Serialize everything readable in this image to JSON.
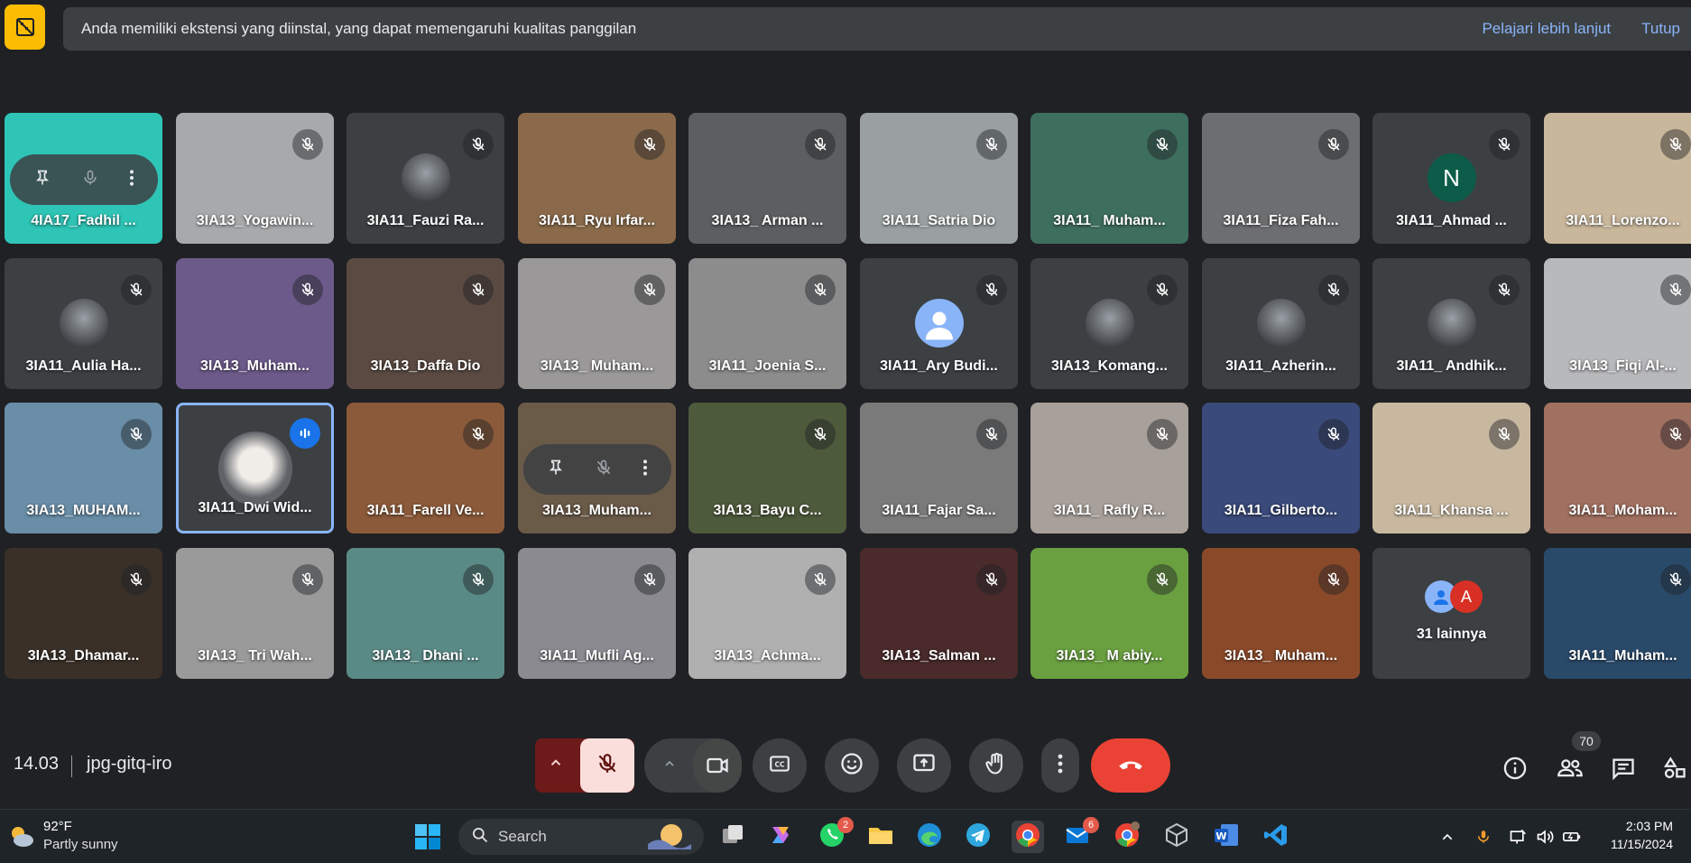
{
  "banner": {
    "message": "Anda memiliki ekstensi yang diinstal, yang dapat memengaruhi kualitas panggilan",
    "learn_more": "Pelajari lebih lanjut",
    "close": "Tutup"
  },
  "participants": [
    {
      "name": "4IA17_Fadhil ...",
      "bg": "#2ec4b6"
    },
    {
      "name": "3IA13_Yogawin...",
      "bg": "#a8a9ab"
    },
    {
      "name": "3IA11_Fauzi Ra...",
      "bg": "#3c4043",
      "avatar": "photo"
    },
    {
      "name": "3IA11_Ryu Irfar...",
      "bg": "#8a6a4a"
    },
    {
      "name": "3IA13_ Arman ...",
      "bg": "#5d5e60"
    },
    {
      "name": "3IA11_Satria Dio",
      "bg": "#9aa0a0"
    },
    {
      "name": "3IA11_ Muham...",
      "bg": "#3e6e5e"
    },
    {
      "name": "3IA11_Fiza Fah...",
      "bg": "#6d6e70"
    },
    {
      "name": "3IA11_Ahmad ...",
      "bg": "#3c4043",
      "avatar": "N",
      "avatar_color": "#0d5c4a"
    },
    {
      "name": "3IA11_Lorenzo...",
      "bg": "#c9b79c"
    },
    {
      "name": "3IA11_Aulia Ha...",
      "bg": "#3c4043",
      "avatar": "photo"
    },
    {
      "name": "3IA13_Muham...",
      "bg": "#6c5a8a"
    },
    {
      "name": "3IA13_Daffa Dio",
      "bg": "#5a4a42"
    },
    {
      "name": "3IA13_ Muham...",
      "bg": "#9a9898"
    },
    {
      "name": "3IA11_Joenia S...",
      "bg": "#8c8c8c"
    },
    {
      "name": "3IA11_Ary Budi...",
      "bg": "#3c4043",
      "avatar": "person",
      "avatar_color": "#8ab4f8"
    },
    {
      "name": "3IA13_Komang...",
      "bg": "#3c4043",
      "avatar": "photo"
    },
    {
      "name": "3IA11_Azherin...",
      "bg": "#3c4043",
      "avatar": "photo"
    },
    {
      "name": "3IA11_ Andhik...",
      "bg": "#3c4043",
      "avatar": "photo"
    },
    {
      "name": "3IA13_Fiqi Al-...",
      "bg": "#b8b9bb"
    },
    {
      "name": "3IA13_MUHAM...",
      "bg": "#6a8ea8"
    },
    {
      "name": "3IA11_Dwi Wid...",
      "bg": "#3c4043",
      "avatar": "photo",
      "active": true
    },
    {
      "name": "3IA11_Farell Ve...",
      "bg": "#8b5a3a"
    },
    {
      "name": "3IA13_Muham...",
      "bg": "#6a5a48",
      "hover": true
    },
    {
      "name": "3IA13_Bayu C...",
      "bg": "#4e5a3c"
    },
    {
      "name": "3IA11_Fajar Sa...",
      "bg": "#7a7a7a"
    },
    {
      "name": "3IA11_ Rafly R...",
      "bg": "#a8a09a"
    },
    {
      "name": "3IA11_Gilberto...",
      "bg": "#3a4a7a"
    },
    {
      "name": "3IA11_Khansa ...",
      "bg": "#c8b8a0"
    },
    {
      "name": "3IA11_Moham...",
      "bg": "#a07060"
    },
    {
      "name": "3IA13_Dhamar...",
      "bg": "#3a3028"
    },
    {
      "name": "3IA13_ Tri Wah...",
      "bg": "#9a9a9a"
    },
    {
      "name": "3IA13_ Dhani ...",
      "bg": "#5a8a86"
    },
    {
      "name": "3IA11_Mufli Ag...",
      "bg": "#8a8a90"
    },
    {
      "name": "3IA13_Achma...",
      "bg": "#b0b0b0"
    },
    {
      "name": "3IA13_Salman ...",
      "bg": "#4a2a2a"
    },
    {
      "name": "3IA13_ M abiy...",
      "bg": "#6aa040"
    },
    {
      "name": "3IA13_ Muham...",
      "bg": "#8a4a2a"
    },
    {
      "name": "31 lainnya",
      "bg": "#3c4043",
      "more": true
    },
    {
      "name": "3IA11_Muham...",
      "bg": "#2a4a6a"
    }
  ],
  "meeting": {
    "time": "14.03",
    "code": "jpg-gitq-iro",
    "participant_count": "70"
  },
  "taskbar": {
    "weather_temp": "92°F",
    "weather_desc": "Partly sunny",
    "search_label": "Search",
    "whatsapp_badge": "2",
    "mail_badge": "6",
    "clock_time": "2:03 PM",
    "clock_date": "11/15/2024"
  }
}
